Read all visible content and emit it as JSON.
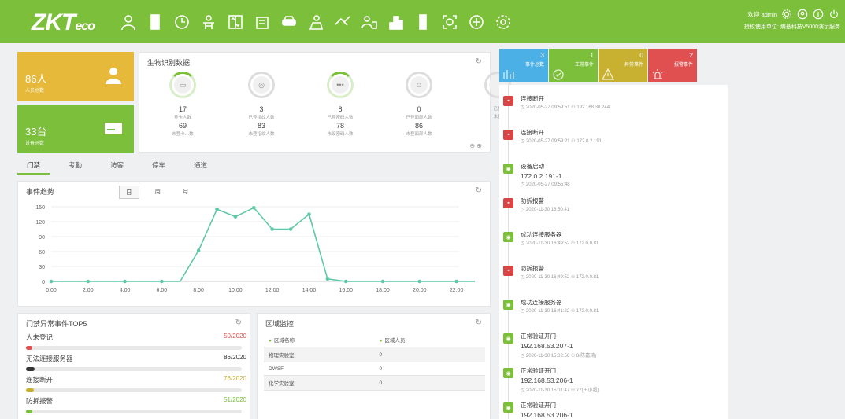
{
  "brand": {
    "logo_main": "ZKT",
    "logo_sub": "eco"
  },
  "nav": {
    "icons": [
      "person-icon",
      "door-icon",
      "clock-icon",
      "visitor-icon",
      "elevator-icon",
      "consumption-icon",
      "parking-icon",
      "patrol-icon",
      "handshake-icon",
      "staff-icon",
      "building-icon",
      "device-icon",
      "face-scan-icon",
      "shield-icon",
      "settings-icon"
    ]
  },
  "user": {
    "welcome": "欢迎 admin",
    "licensed": "授权使用单位: 熵基科技V5000演示服务"
  },
  "stats": {
    "people": {
      "value": "86人",
      "label": "人员总数"
    },
    "devices": {
      "value": "33台",
      "label": "设备总数"
    }
  },
  "bio": {
    "title": "生物识别数据",
    "items": [
      {
        "value": "17",
        "label": "登卡人数",
        "value2": "69",
        "label2": "未登卡人数",
        "glyph": "▭",
        "active": true
      },
      {
        "value": "3",
        "label": "已登指纹人数",
        "value2": "83",
        "label2": "未登指纹人数",
        "glyph": "◎",
        "active": false
      },
      {
        "value": "8",
        "label": "已登密码人数",
        "value2": "78",
        "label2": "未设密码人数",
        "glyph": "•••",
        "active": true
      },
      {
        "value": "0",
        "label": "已登面部人数",
        "value2": "86",
        "label2": "未登面部人数",
        "glyph": "☺",
        "active": false
      },
      {
        "value": "",
        "label": "已登",
        "value2": "",
        "label2": "未登",
        "glyph": "",
        "active": false
      }
    ]
  },
  "tabs": [
    "门禁",
    "考勤",
    "访客",
    "停车",
    "通道"
  ],
  "trend": {
    "title": "事件趋势",
    "periods": [
      "日",
      "周",
      "月"
    ]
  },
  "chart_data": {
    "type": "line",
    "title": "事件趋势",
    "x": [
      "0:00",
      "1:00",
      "2:00",
      "3:00",
      "4:00",
      "5:00",
      "6:00",
      "7:00",
      "8:00",
      "9:00",
      "10:00",
      "11:00",
      "12:00",
      "13:00",
      "14:00",
      "15:00",
      "16:00",
      "17:00",
      "18:00",
      "19:00",
      "20:00",
      "21:00",
      "22:00",
      "23:00"
    ],
    "values": [
      0,
      0,
      0,
      0,
      0,
      0,
      0,
      0,
      62,
      145,
      130,
      148,
      105,
      105,
      135,
      5,
      0,
      0,
      0,
      0,
      0,
      0,
      0,
      0
    ],
    "xticks": [
      "0:00",
      "2:00",
      "4:00",
      "6:00",
      "8:00",
      "10:00",
      "12:00",
      "14:00",
      "16:00",
      "18:00",
      "20:00",
      "22:00"
    ],
    "yticks": [
      0,
      30,
      60,
      90,
      120,
      150
    ],
    "ylim": [
      0,
      150
    ],
    "color": "#5fc8a8"
  },
  "top5": {
    "title": "门禁异常事件TOP5",
    "rows": [
      {
        "name": "人未登记",
        "count": "50/2020",
        "color": "#e05050",
        "frac": 0.025
      },
      {
        "name": "无法连接服务器",
        "count": "86/2020",
        "color": "#333333",
        "frac": 0.04
      },
      {
        "name": "连接断开",
        "count": "76/2020",
        "color": "#c8b030",
        "frac": 0.035
      },
      {
        "name": "防拆报警",
        "count": "51/2020",
        "color": "#7bbf3a",
        "frac": 0.025
      }
    ]
  },
  "area": {
    "title": "区域监控",
    "col1": "区域名称",
    "col2": "区域人员",
    "rows": [
      {
        "name": "物理实验室",
        "count": "0"
      },
      {
        "name": "DWSF",
        "count": "0"
      },
      {
        "name": "化学实验室",
        "count": "0"
      }
    ]
  },
  "summary": [
    {
      "num": "3",
      "label": "事件总数",
      "color": "#4ab0e6"
    },
    {
      "num": "1",
      "label": "正常事件",
      "color": "#7bbf3a"
    },
    {
      "num": "0",
      "label": "异常事件",
      "color": "#c8b030"
    },
    {
      "num": "2",
      "label": "报警事件",
      "color": "#e05050"
    }
  ],
  "events": [
    {
      "type": "red",
      "title": "连接断开",
      "sub": "",
      "meta": "◷ 2020-05-27 09:59:51  ⚇ 192.168.30.244"
    },
    {
      "type": "red",
      "title": "连接断开",
      "sub": "",
      "meta": "◷ 2020-05-27 09:59:21  ⚇ 172.0.2.191"
    },
    {
      "type": "green",
      "title": "设备启动",
      "sub": "172.0.2.191-1",
      "meta": "◷ 2020-05-27 09:55:48"
    },
    {
      "type": "red",
      "title": "防拆报警",
      "sub": "",
      "meta": "◷ 2020-11-30 16:50:41"
    },
    {
      "type": "green",
      "title": "成功连接服务器",
      "sub": "",
      "meta": "◷ 2020-11-30 16:49:52  ⚇ 172.0.0.81"
    },
    {
      "type": "red",
      "title": "防拆报警",
      "sub": "",
      "meta": "◷ 2020-11-30 16:49:52  ⚇ 172.0.0.81"
    },
    {
      "type": "green",
      "title": "成功连接服务器",
      "sub": "",
      "meta": "◷ 2020-11-30 16:41:22  ⚇ 172.0.0.81"
    },
    {
      "type": "green",
      "title": "正常验证开门",
      "sub": "192.168.53.207-1",
      "meta": "◷ 2020-11-30 15:02:56  ⚇ 8(陈嘉琦)"
    },
    {
      "type": "green",
      "title": "正常验证开门",
      "sub": "192.168.53.206-1",
      "meta": "◷ 2020-11-30 15:01:47  ⚇ 77(王小超)"
    },
    {
      "type": "green",
      "title": "正常验证开门",
      "sub": "192.168.53.206-1",
      "meta": ""
    }
  ]
}
